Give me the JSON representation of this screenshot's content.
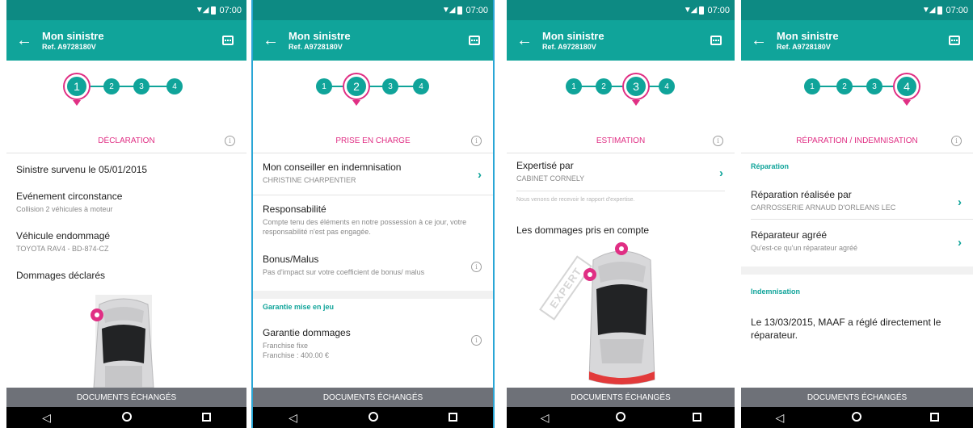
{
  "status": {
    "time": "07:00"
  },
  "app": {
    "title": "Mon sinistre",
    "ref": "Ref. A9728180V"
  },
  "steps": [
    "1",
    "2",
    "3",
    "4"
  ],
  "footer": {
    "label": "DOCUMENTS ÉCHANGÉS"
  },
  "icons": {
    "back": "arrow-left-icon",
    "chat": "chat-icon",
    "info": "info-icon",
    "chevron": "chevron-right-icon"
  },
  "colors": {
    "teal": "#10a49a",
    "teal_dark": "#0d8a83",
    "pink": "#e02f84",
    "footer": "#6e7178"
  },
  "screen1": {
    "section": "DÉCLARATION",
    "date_line": "Sinistre survenu le 05/01/2015",
    "event_title": "Evénement circonstance",
    "event_value": "Collision 2 véhicules à moteur",
    "vehicle_title": "Véhicule endommagé",
    "vehicle_value": "TOYOTA RAV4 - BD-874-CZ",
    "damages_title": "Dommages déclarés"
  },
  "screen2": {
    "section": "PRISE EN CHARGE",
    "advisor_title": "Mon conseiller en indemnisation",
    "advisor_value": "CHRISTINE CHARPENTIER",
    "resp_title": "Responsabilité",
    "resp_value": "Compte tenu des éléments en notre possession à ce jour, votre responsabilité n'est pas engagée.",
    "bonus_title": "Bonus/Malus",
    "bonus_value": "Pas d'impact sur votre coefficient de bonus/ malus",
    "guarantee_label": "Garantie mise en jeu",
    "guarantee_title": "Garantie dommages",
    "guarantee_line1": "Franchise fixe",
    "guarantee_line2": "Franchise : 400.00 €"
  },
  "screen3": {
    "section": "ESTIMATION",
    "expert_title": "Expertisé par",
    "expert_value": "CABINET CORNELY",
    "note": "Nous venons de recevoir le rapport d'expertise.",
    "damages_title": "Les dommages pris en compte",
    "stamp": "EXPERT"
  },
  "screen4": {
    "section": "RÉPARATION / INDEMNISATION",
    "repair_label": "Réparation",
    "repair_title": "Réparation réalisée par",
    "repair_value": "CARROSSERIE ARNAUD D'ORLEANS LEC",
    "approved_title": "Réparateur agréé",
    "approved_value": "Qu'est-ce qu'un réparateur agréé",
    "indemn_label": "Indemnisation",
    "indemn_text": "Le 13/03/2015, MAAF a réglé directement le réparateur."
  }
}
